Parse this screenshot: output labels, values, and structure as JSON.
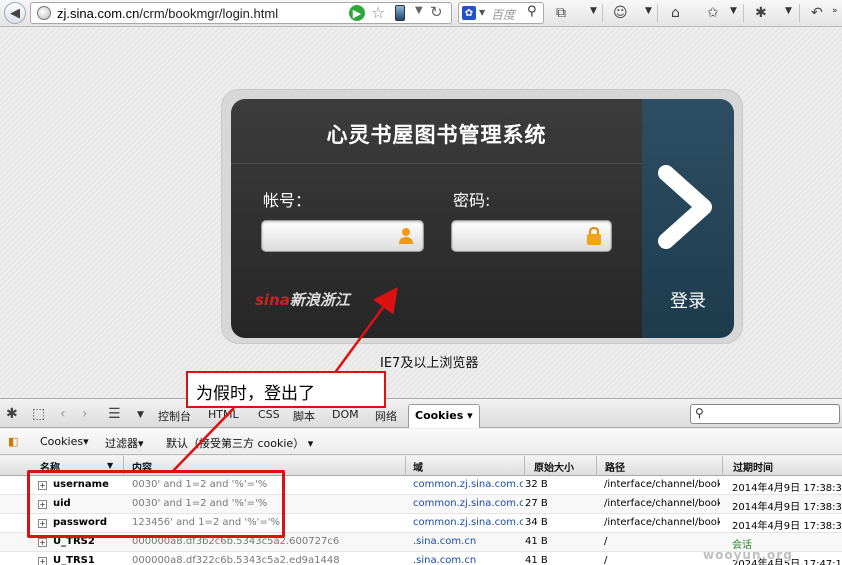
{
  "browser": {
    "url_host": "zj.sina.com.cn",
    "url_path": "/crm/bookmgr/login.html",
    "search_placeholder": "百度"
  },
  "login": {
    "title": "心灵书屋图书管理系统",
    "account_label": "帐号：",
    "password_label": "密码:",
    "login_button": "登录",
    "logo_text": "新浪浙江",
    "logo_brand": "sina",
    "browser_note": "IE7及以上浏览器"
  },
  "firebug": {
    "tabs": [
      "控制台",
      "HTML",
      "CSS",
      "脚本",
      "DOM",
      "网络"
    ],
    "active_tab": "Cookies",
    "subbar": {
      "cookies_menu": "Cookies",
      "filter_menu": "过滤器",
      "default_menu": "默认（接受第三方 cookie）"
    },
    "columns": [
      "名称",
      "内容",
      "域",
      "原始大小",
      "路径",
      "过期时间"
    ],
    "rows": [
      {
        "name": "username",
        "value": "0030' and 1=2 and '%'='%",
        "domain": "common.zj.sina.com.cn",
        "size": "32 B",
        "path": "/interface/channel/book/",
        "expires": "2014年4月9日 17:38:3"
      },
      {
        "name": "uid",
        "value": "0030' and 1=2 and '%'='%",
        "domain": "common.zj.sina.com.cn",
        "size": "27 B",
        "path": "/interface/channel/book/",
        "expires": "2014年4月9日 17:38:3"
      },
      {
        "name": "password",
        "value": "123456' and 1=2 and '%'='%",
        "domain": "common.zj.sina.com.cn",
        "size": "34 B",
        "path": "/interface/channel/book/",
        "expires": "2014年4月9日 17:38:3"
      },
      {
        "name": "U_TRS2",
        "value": "000000a8.df3b2c6b.5343c5a2.600727c6",
        "domain": ".sina.com.cn",
        "size": "41 B",
        "path": "/",
        "expires": "会话"
      },
      {
        "name": "U_TRS1",
        "value": "000000a8.df322c6b.5343c5a2.ed9a1448",
        "domain": ".sina.com.cn",
        "size": "41 B",
        "path": "/",
        "expires": "2024年4月5日 17:47:1"
      }
    ]
  },
  "annotation": {
    "callout": "为假时，登出了"
  },
  "watermark": "wooyun.org"
}
